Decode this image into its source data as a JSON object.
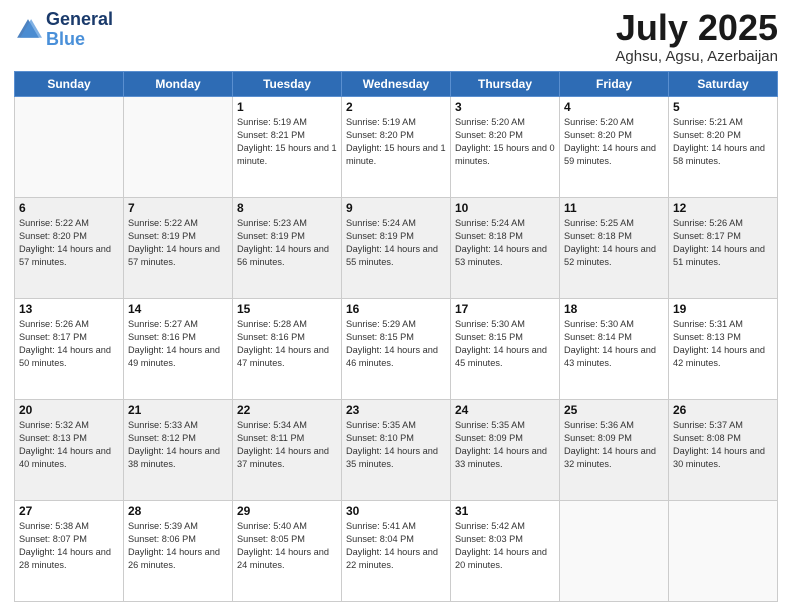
{
  "logo": {
    "line1": "General",
    "line2": "Blue"
  },
  "title": "July 2025",
  "location": "Aghsu, Agsu, Azerbaijan",
  "days_of_week": [
    "Sunday",
    "Monday",
    "Tuesday",
    "Wednesday",
    "Thursday",
    "Friday",
    "Saturday"
  ],
  "weeks": [
    [
      {
        "day": "",
        "sunrise": "",
        "sunset": "",
        "daylight": ""
      },
      {
        "day": "",
        "sunrise": "",
        "sunset": "",
        "daylight": ""
      },
      {
        "day": "1",
        "sunrise": "Sunrise: 5:19 AM",
        "sunset": "Sunset: 8:21 PM",
        "daylight": "Daylight: 15 hours and 1 minute."
      },
      {
        "day": "2",
        "sunrise": "Sunrise: 5:19 AM",
        "sunset": "Sunset: 8:20 PM",
        "daylight": "Daylight: 15 hours and 1 minute."
      },
      {
        "day": "3",
        "sunrise": "Sunrise: 5:20 AM",
        "sunset": "Sunset: 8:20 PM",
        "daylight": "Daylight: 15 hours and 0 minutes."
      },
      {
        "day": "4",
        "sunrise": "Sunrise: 5:20 AM",
        "sunset": "Sunset: 8:20 PM",
        "daylight": "Daylight: 14 hours and 59 minutes."
      },
      {
        "day": "5",
        "sunrise": "Sunrise: 5:21 AM",
        "sunset": "Sunset: 8:20 PM",
        "daylight": "Daylight: 14 hours and 58 minutes."
      }
    ],
    [
      {
        "day": "6",
        "sunrise": "Sunrise: 5:22 AM",
        "sunset": "Sunset: 8:20 PM",
        "daylight": "Daylight: 14 hours and 57 minutes."
      },
      {
        "day": "7",
        "sunrise": "Sunrise: 5:22 AM",
        "sunset": "Sunset: 8:19 PM",
        "daylight": "Daylight: 14 hours and 57 minutes."
      },
      {
        "day": "8",
        "sunrise": "Sunrise: 5:23 AM",
        "sunset": "Sunset: 8:19 PM",
        "daylight": "Daylight: 14 hours and 56 minutes."
      },
      {
        "day": "9",
        "sunrise": "Sunrise: 5:24 AM",
        "sunset": "Sunset: 8:19 PM",
        "daylight": "Daylight: 14 hours and 55 minutes."
      },
      {
        "day": "10",
        "sunrise": "Sunrise: 5:24 AM",
        "sunset": "Sunset: 8:18 PM",
        "daylight": "Daylight: 14 hours and 53 minutes."
      },
      {
        "day": "11",
        "sunrise": "Sunrise: 5:25 AM",
        "sunset": "Sunset: 8:18 PM",
        "daylight": "Daylight: 14 hours and 52 minutes."
      },
      {
        "day": "12",
        "sunrise": "Sunrise: 5:26 AM",
        "sunset": "Sunset: 8:17 PM",
        "daylight": "Daylight: 14 hours and 51 minutes."
      }
    ],
    [
      {
        "day": "13",
        "sunrise": "Sunrise: 5:26 AM",
        "sunset": "Sunset: 8:17 PM",
        "daylight": "Daylight: 14 hours and 50 minutes."
      },
      {
        "day": "14",
        "sunrise": "Sunrise: 5:27 AM",
        "sunset": "Sunset: 8:16 PM",
        "daylight": "Daylight: 14 hours and 49 minutes."
      },
      {
        "day": "15",
        "sunrise": "Sunrise: 5:28 AM",
        "sunset": "Sunset: 8:16 PM",
        "daylight": "Daylight: 14 hours and 47 minutes."
      },
      {
        "day": "16",
        "sunrise": "Sunrise: 5:29 AM",
        "sunset": "Sunset: 8:15 PM",
        "daylight": "Daylight: 14 hours and 46 minutes."
      },
      {
        "day": "17",
        "sunrise": "Sunrise: 5:30 AM",
        "sunset": "Sunset: 8:15 PM",
        "daylight": "Daylight: 14 hours and 45 minutes."
      },
      {
        "day": "18",
        "sunrise": "Sunrise: 5:30 AM",
        "sunset": "Sunset: 8:14 PM",
        "daylight": "Daylight: 14 hours and 43 minutes."
      },
      {
        "day": "19",
        "sunrise": "Sunrise: 5:31 AM",
        "sunset": "Sunset: 8:13 PM",
        "daylight": "Daylight: 14 hours and 42 minutes."
      }
    ],
    [
      {
        "day": "20",
        "sunrise": "Sunrise: 5:32 AM",
        "sunset": "Sunset: 8:13 PM",
        "daylight": "Daylight: 14 hours and 40 minutes."
      },
      {
        "day": "21",
        "sunrise": "Sunrise: 5:33 AM",
        "sunset": "Sunset: 8:12 PM",
        "daylight": "Daylight: 14 hours and 38 minutes."
      },
      {
        "day": "22",
        "sunrise": "Sunrise: 5:34 AM",
        "sunset": "Sunset: 8:11 PM",
        "daylight": "Daylight: 14 hours and 37 minutes."
      },
      {
        "day": "23",
        "sunrise": "Sunrise: 5:35 AM",
        "sunset": "Sunset: 8:10 PM",
        "daylight": "Daylight: 14 hours and 35 minutes."
      },
      {
        "day": "24",
        "sunrise": "Sunrise: 5:35 AM",
        "sunset": "Sunset: 8:09 PM",
        "daylight": "Daylight: 14 hours and 33 minutes."
      },
      {
        "day": "25",
        "sunrise": "Sunrise: 5:36 AM",
        "sunset": "Sunset: 8:09 PM",
        "daylight": "Daylight: 14 hours and 32 minutes."
      },
      {
        "day": "26",
        "sunrise": "Sunrise: 5:37 AM",
        "sunset": "Sunset: 8:08 PM",
        "daylight": "Daylight: 14 hours and 30 minutes."
      }
    ],
    [
      {
        "day": "27",
        "sunrise": "Sunrise: 5:38 AM",
        "sunset": "Sunset: 8:07 PM",
        "daylight": "Daylight: 14 hours and 28 minutes."
      },
      {
        "day": "28",
        "sunrise": "Sunrise: 5:39 AM",
        "sunset": "Sunset: 8:06 PM",
        "daylight": "Daylight: 14 hours and 26 minutes."
      },
      {
        "day": "29",
        "sunrise": "Sunrise: 5:40 AM",
        "sunset": "Sunset: 8:05 PM",
        "daylight": "Daylight: 14 hours and 24 minutes."
      },
      {
        "day": "30",
        "sunrise": "Sunrise: 5:41 AM",
        "sunset": "Sunset: 8:04 PM",
        "daylight": "Daylight: 14 hours and 22 minutes."
      },
      {
        "day": "31",
        "sunrise": "Sunrise: 5:42 AM",
        "sunset": "Sunset: 8:03 PM",
        "daylight": "Daylight: 14 hours and 20 minutes."
      },
      {
        "day": "",
        "sunrise": "",
        "sunset": "",
        "daylight": ""
      },
      {
        "day": "",
        "sunrise": "",
        "sunset": "",
        "daylight": ""
      }
    ]
  ]
}
